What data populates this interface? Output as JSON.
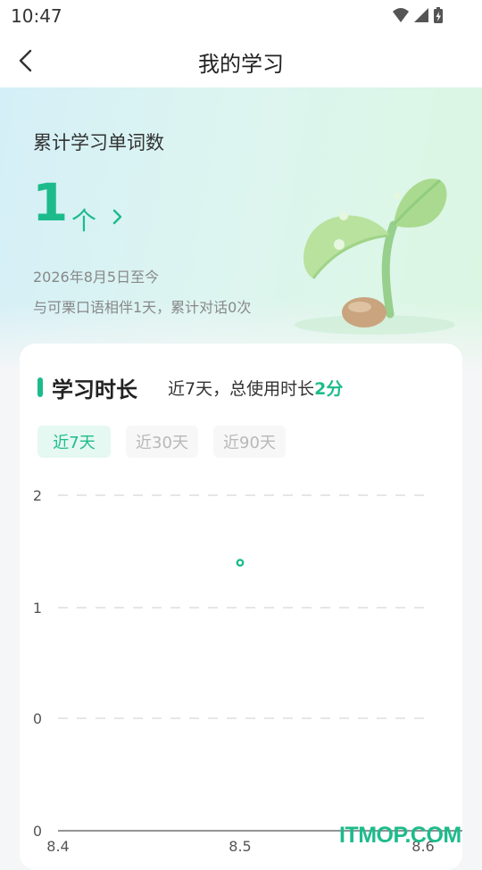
{
  "status_bar": {
    "time": "10:47",
    "icons": [
      "wifi-icon",
      "cell-signal-icon",
      "battery-icon"
    ]
  },
  "nav": {
    "title": "我的学习",
    "back_icon": "chevron-left-icon"
  },
  "summary": {
    "title": "累计学习单词数",
    "count": "1",
    "unit": "个",
    "date_range": "2026年8月5日至今",
    "description": "与可栗口语相伴1天，累计对话0次"
  },
  "study_time": {
    "title": "学习时长",
    "subtitle_prefix": "近7天，总使用时长",
    "subtitle_value": "2分",
    "tabs": [
      {
        "label": "近7天",
        "active": true
      },
      {
        "label": "近30天",
        "active": false
      },
      {
        "label": "近90天",
        "active": false
      }
    ]
  },
  "chart_data": {
    "type": "line",
    "x": [
      "8.4",
      "8.5",
      "8.6"
    ],
    "y_ticks": [
      0,
      0,
      1,
      2
    ],
    "series": [
      {
        "values": [
          null,
          1.4,
          null
        ],
        "color": "#1dbb8b"
      }
    ],
    "grid": true,
    "accent_color": "#1dbb8b"
  },
  "watermark": "ITMOP.COM",
  "colors": {
    "accent": "#1dbb8b",
    "tab_active_bg": "#e5f8f1",
    "tab_idle_bg": "#f7f7f7"
  }
}
